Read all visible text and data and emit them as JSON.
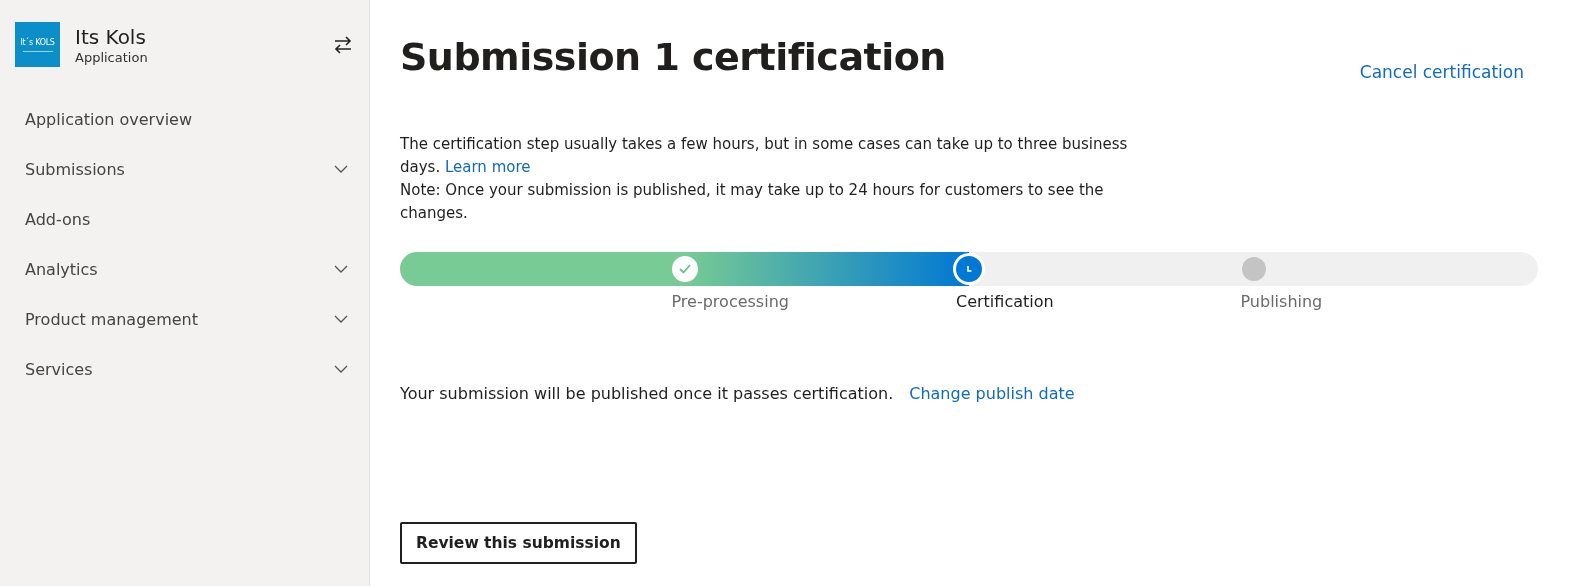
{
  "app": {
    "logo_text": "It´s KOLS",
    "name": "Its Kols",
    "type": "Application"
  },
  "sidebar": {
    "items": [
      {
        "label": "Application overview",
        "expandable": false
      },
      {
        "label": "Submissions",
        "expandable": true
      },
      {
        "label": "Add-ons",
        "expandable": false
      },
      {
        "label": "Analytics",
        "expandable": true
      },
      {
        "label": "Product management",
        "expandable": true
      },
      {
        "label": "Services",
        "expandable": true
      }
    ]
  },
  "title": "Submission 1 certification",
  "cancel_link": "Cancel certification",
  "intro": {
    "text": "The certification step usually takes a few hours, but in some cases can take up to three business days.",
    "link": "Learn more"
  },
  "note": "Note: Once your submission is published, it may take up to 24 hours for customers to see the changes.",
  "progress": {
    "level": 0.5,
    "steps": [
      {
        "label": "Pre-processing",
        "kind": "done"
      },
      {
        "label": "Certification",
        "kind": "current"
      },
      {
        "label": "Publishing",
        "kind": "pending"
      }
    ]
  },
  "publish": {
    "text": "Your submission will be published once it passes certification.",
    "link": "Change publish date"
  },
  "review_button": "Review this submission"
}
